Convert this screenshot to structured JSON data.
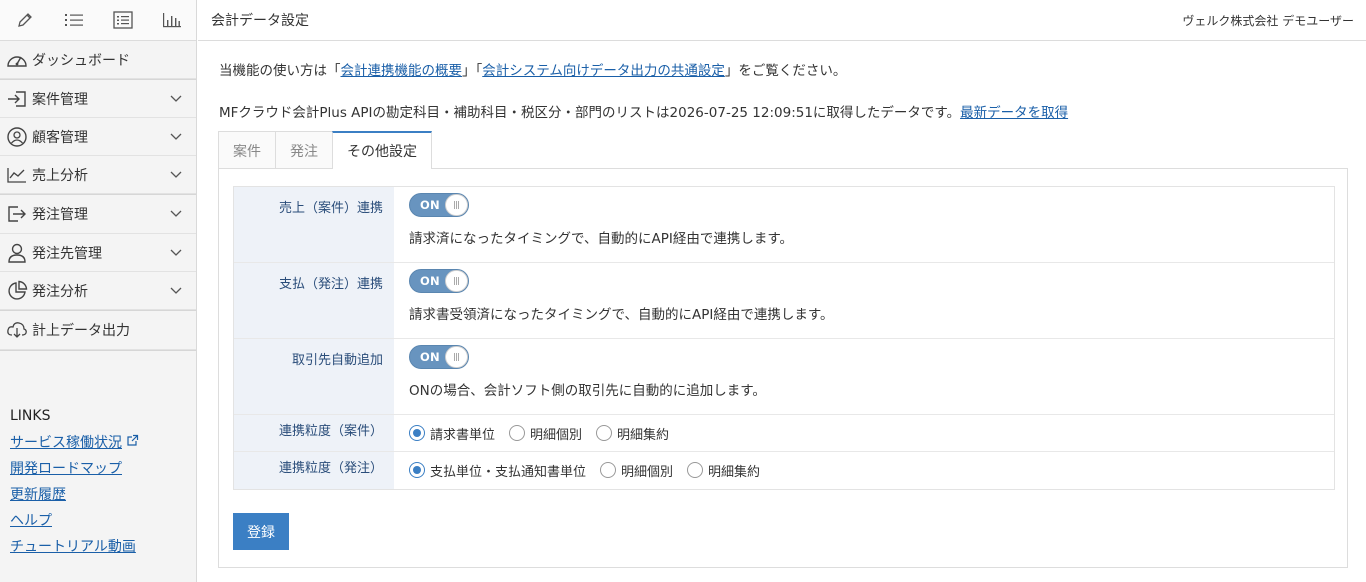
{
  "header": {
    "title": "会計データ設定",
    "user": "ヴェルク株式会社 デモユーザー"
  },
  "sidebar": {
    "top_icons": [
      "pencil-icon",
      "list-icon",
      "list-box-icon",
      "bar-chart-icon"
    ],
    "items": [
      {
        "label": "ダッシュボード",
        "icon": "dashboard-icon"
      },
      {
        "label": "案件管理",
        "icon": "login-icon"
      },
      {
        "label": "顧客管理",
        "icon": "user-circle-icon"
      },
      {
        "label": "売上分析",
        "icon": "line-chart-icon"
      },
      {
        "label": "発注管理",
        "icon": "share-arrow-icon"
      },
      {
        "label": "発注先管理",
        "icon": "person-icon"
      },
      {
        "label": "発注分析",
        "icon": "pie-chart-icon"
      },
      {
        "label": "計上データ出力",
        "icon": "download-cloud-icon"
      }
    ],
    "links_title": "LINKS",
    "links": [
      "サービス稼働状況",
      "開発ロードマップ",
      "更新履歴",
      "ヘルプ",
      "チュートリアル動画"
    ]
  },
  "info": {
    "line1_prefix": "当機能の使い方は「",
    "line1_link1": "会計連携機能の概要",
    "line1_mid": "」「",
    "line1_link2": "会計システム向けデータ出力の共通設定",
    "line1_suffix": "」をご覧ください。",
    "line2_text": "MFクラウド会計Plus APIの勘定科目・補助科目・税区分・部門のリストは2026-07-25 12:09:51に取得したデータです。",
    "line2_link": "最新データを取得"
  },
  "tabs": [
    "案件",
    "発注",
    "その他設定"
  ],
  "settings": {
    "rows": [
      {
        "label": "売上（案件）連携",
        "toggle": "ON",
        "desc": "請求済になったタイミングで、自動的にAPI経由で連携します。"
      },
      {
        "label": "支払（発注）連携",
        "toggle": "ON",
        "desc": "請求書受領済になったタイミングで、自動的にAPI経由で連携します。"
      },
      {
        "label": "取引先自動追加",
        "toggle": "ON",
        "desc": "ONの場合、会計ソフト側の取引先に自動的に追加します。"
      }
    ],
    "granularity_order": {
      "label": "連携粒度（案件）",
      "options": [
        "請求書単位",
        "明細個別",
        "明細集約"
      ],
      "selected": "請求書単位"
    },
    "granularity_purchase": {
      "label": "連携粒度（発注）",
      "options": [
        "支払単位・支払通知書単位",
        "明細個別",
        "明細集約"
      ],
      "selected": "支払単位・支払通知書単位"
    }
  },
  "submit_label": "登録",
  "colors": {
    "accent": "#3b7fc4",
    "toggle": "#6894bf",
    "link": "#1a5fa8",
    "label_bg": "#eef2f8"
  }
}
